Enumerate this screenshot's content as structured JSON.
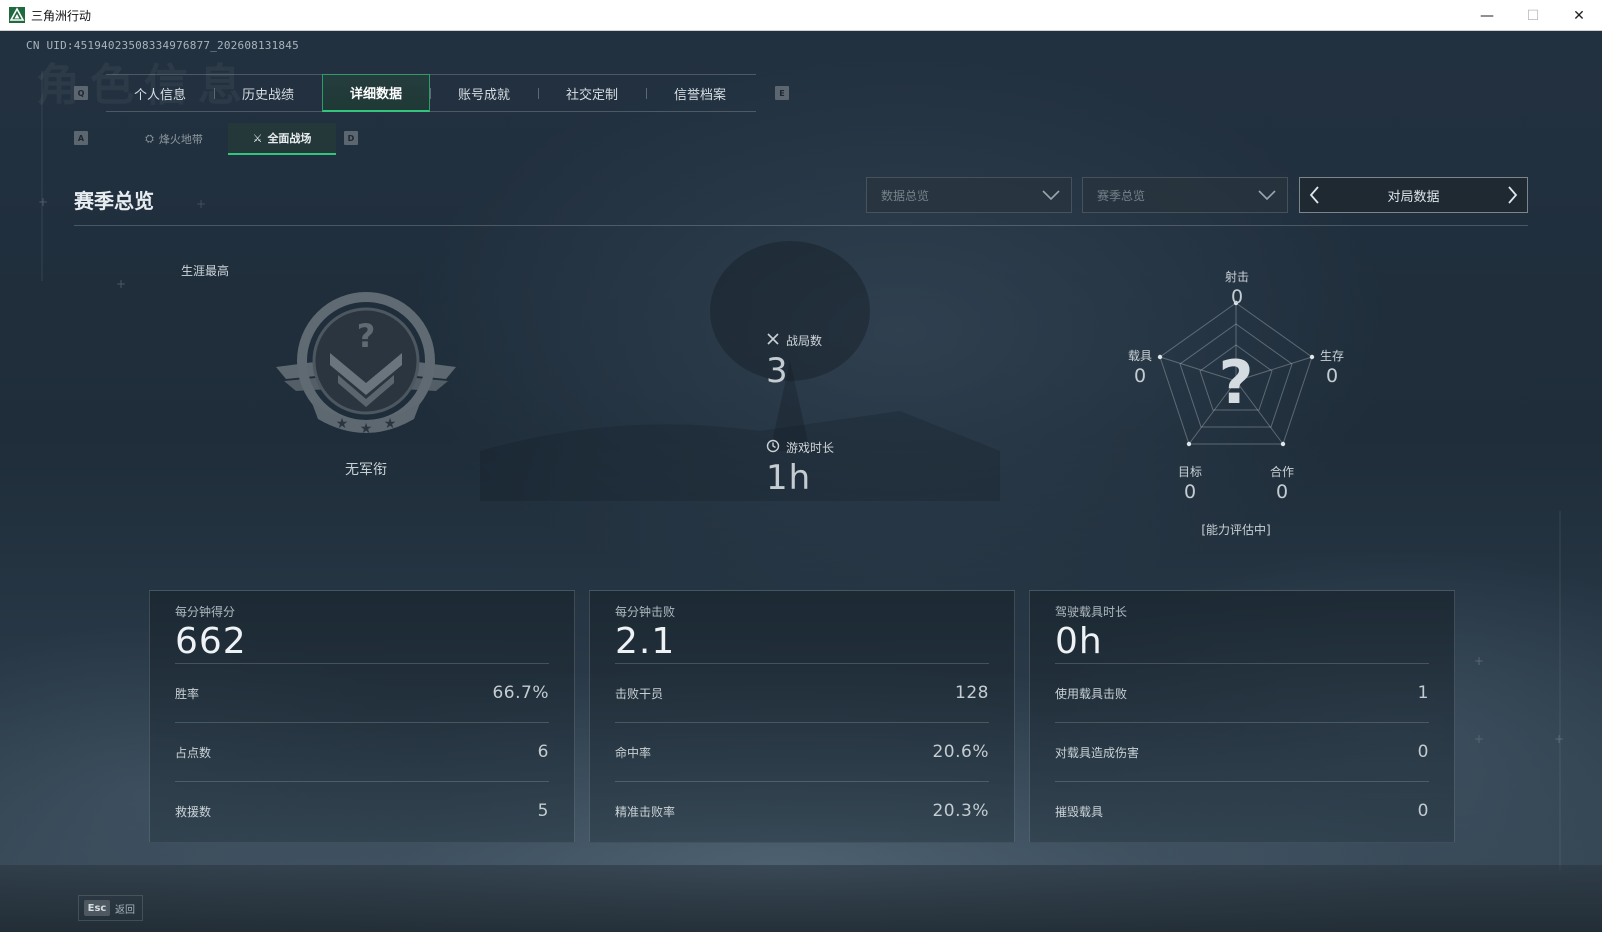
{
  "window": {
    "title": "三角洲行动",
    "minimize_glyph": "—",
    "maximize_glyph": "☐",
    "close_glyph": "✕"
  },
  "uid_text": "CN UID:4519402350833497687​7_202608131845",
  "ghost_title": "角色信息",
  "keyhints": {
    "prev_tab": "Q",
    "next_tab": "E",
    "prev_sub": "A",
    "next_sub": "D"
  },
  "main_tabs": [
    {
      "label": "个人信息",
      "active": false
    },
    {
      "label": "历史战绩",
      "active": false
    },
    {
      "label": "详细数据",
      "active": true
    },
    {
      "label": "账号成就",
      "active": false
    },
    {
      "label": "社交定制",
      "active": false
    },
    {
      "label": "信誉档案",
      "active": false
    }
  ],
  "sub_tabs": [
    {
      "label": "烽火地带",
      "icon": "extraction-icon",
      "active": false
    },
    {
      "label": "全面战场",
      "icon": "battlefield-icon",
      "active": true
    }
  ],
  "section": {
    "title": "赛季总览",
    "dropdown_1": "数据总览",
    "dropdown_2": "赛季总览",
    "pager_label": "对局数据"
  },
  "career": {
    "label": "生涯最高",
    "rank_name": "无军衔",
    "emblem_icon": "rank-emblem-icon"
  },
  "summary": {
    "matches_label": "战局数",
    "matches_value": "3",
    "playtime_label": "游戏时长",
    "playtime_value": "1h"
  },
  "radar": {
    "axes": [
      {
        "key": "shooting",
        "label": "射击",
        "value": "0"
      },
      {
        "key": "survival",
        "label": "生存",
        "value": "0"
      },
      {
        "key": "cooperation",
        "label": "合作",
        "value": "0"
      },
      {
        "key": "objective",
        "label": "目标",
        "value": "0"
      },
      {
        "key": "vehicle",
        "label": "载具",
        "value": "0"
      }
    ],
    "center_glyph": "?",
    "status": "[能力评估中]"
  },
  "cards": [
    {
      "head_label": "每分钟得分",
      "head_value": "662",
      "rows": [
        {
          "label": "胜率",
          "value": "66.7%"
        },
        {
          "label": "占点数",
          "value": "6"
        },
        {
          "label": "救援数",
          "value": "5"
        }
      ]
    },
    {
      "head_label": "每分钟击败",
      "head_value": "2.1",
      "rows": [
        {
          "label": "击败干员",
          "value": "128"
        },
        {
          "label": "命中率",
          "value": "20.6%"
        },
        {
          "label": "精准击败率",
          "value": "20.3%"
        }
      ]
    },
    {
      "head_label": "驾驶载具时长",
      "head_value": "0h",
      "rows": [
        {
          "label": "使用载具击败",
          "value": "1"
        },
        {
          "label": "对载具造成伤害",
          "value": "0"
        },
        {
          "label": "摧毁载具",
          "value": "0"
        }
      ]
    }
  ],
  "footer": {
    "esc_key": "Esc",
    "back_label": "返回"
  },
  "colors": {
    "accent": "#33c47e",
    "background": "#1f2d3a"
  }
}
